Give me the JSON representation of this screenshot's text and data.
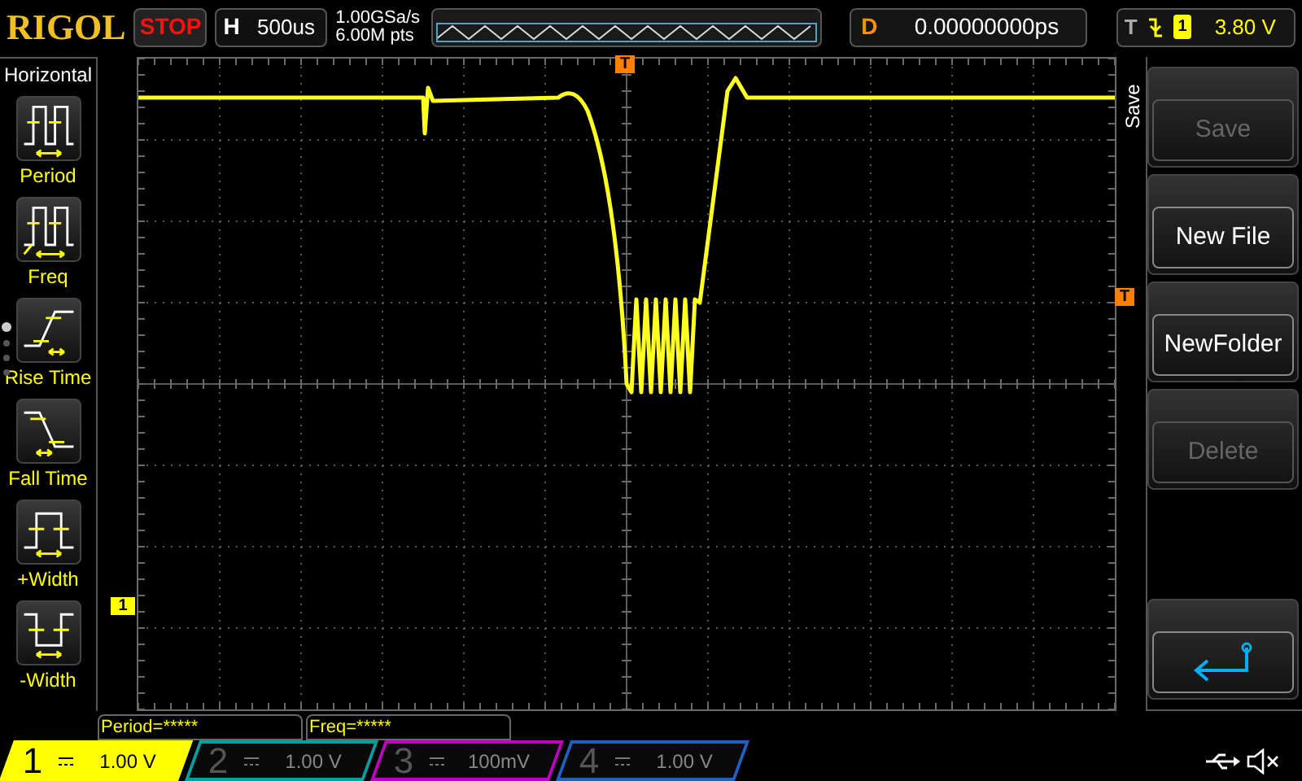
{
  "top_bar": {
    "logo": "RIGOL",
    "run_state": "STOP",
    "horizontal": {
      "label": "H",
      "value": "500us"
    },
    "sample_rate": "1.00GSa/s",
    "memory_depth": "6.00M pts",
    "delay": {
      "label": "D",
      "value": "0.00000000ps"
    },
    "trigger": {
      "label": "T",
      "channel": "1",
      "level": "3.80 V"
    }
  },
  "sidebar": {
    "title": "Horizontal",
    "items": [
      {
        "kind": "period",
        "label": "Period"
      },
      {
        "kind": "freq",
        "label": "Freq"
      },
      {
        "kind": "rise",
        "label": "Rise Time"
      },
      {
        "kind": "fall",
        "label": "Fall Time"
      },
      {
        "kind": "pwidth",
        "label": "+Width"
      },
      {
        "kind": "nwidth",
        "label": "-Width"
      }
    ],
    "pages": [
      {
        "selected": true
      },
      {
        "selected": false
      },
      {
        "selected": false
      },
      {
        "selected": false
      }
    ]
  },
  "screen": {
    "trigger_position_marker": "T",
    "trigger_level_marker": "T",
    "channel_marker": "1"
  },
  "menu": {
    "title": "Save",
    "buttons": [
      {
        "kind": "text",
        "label": "Save",
        "disabled": true
      },
      {
        "kind": "text",
        "label": "New File",
        "disabled": false
      },
      {
        "kind": "text",
        "label": "NewFolder",
        "disabled": false
      },
      {
        "kind": "text",
        "label": "Delete",
        "disabled": true
      },
      {
        "kind": "spacer"
      },
      {
        "kind": "back"
      }
    ]
  },
  "measurements": [
    "Period=*****",
    "Freq=*****"
  ],
  "channels": [
    {
      "number": "1",
      "scale": "1.00 V",
      "selected": true,
      "color": "#ffff00"
    },
    {
      "number": "2",
      "scale": "1.00 V",
      "selected": false,
      "color": "#00a0a0"
    },
    {
      "number": "3",
      "scale": "100mV",
      "selected": false,
      "color": "#c000c0"
    },
    {
      "number": "4",
      "scale": "1.00 V",
      "selected": false,
      "color": "#2060c0"
    }
  ]
}
